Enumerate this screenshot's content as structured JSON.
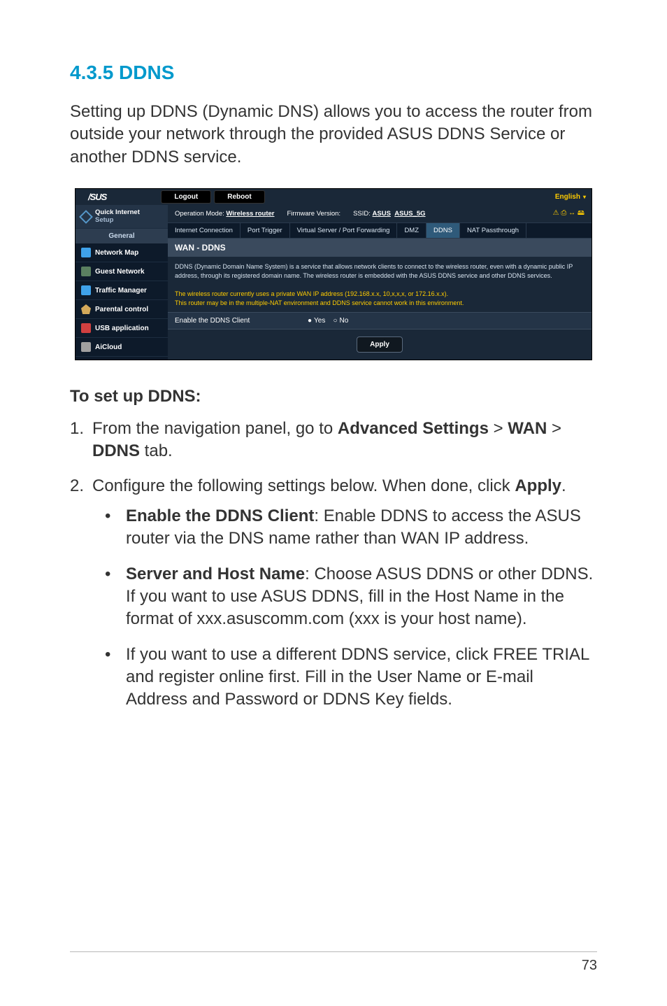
{
  "title": "4.3.5 DDNS",
  "intro": "Setting up DDNS (Dynamic DNS) allows you to access the router from outside your network through the provided ASUS DDNS Service or another DDNS service.",
  "screenshot": {
    "logo": "/SUS",
    "logout": "Logout",
    "reboot": "Reboot",
    "language": "English",
    "op_mode_lbl": "Operation Mode:",
    "op_mode_val": "Wireless router",
    "fw_lbl": "Firmware Version:",
    "ssid_lbl": "SSID:",
    "ssid_val1": "ASUS",
    "ssid_val2": "ASUS_5G",
    "status_icons": "⚠ ⎙ ↔ 🖴",
    "sidebar": {
      "quick1": "Quick Internet",
      "quick2": "Setup",
      "general": "General",
      "items": [
        {
          "label": "Network Map"
        },
        {
          "label": "Guest Network"
        },
        {
          "label": "Traffic Manager"
        },
        {
          "label": "Parental control"
        },
        {
          "label": "USB application"
        },
        {
          "label": "AiCloud"
        }
      ]
    },
    "tabs": {
      "t0": "Internet Connection",
      "t1": "Port Trigger",
      "t2": "Virtual Server / Port Forwarding",
      "t3": "DMZ",
      "t4": "DDNS",
      "t5": "NAT Passthrough"
    },
    "panel_title": "WAN - DDNS",
    "panel_desc": "DDNS (Dynamic Domain Name System) is a service that allows network clients to connect to the wireless router, even with a dynamic public IP address, through its registered domain name. The wireless router is embedded with the ASUS DDNS service and other DDNS services.",
    "panel_warn1": "The wireless router currently uses a private WAN IP address (192.168.x.x, 10,x,x,x, or 172.16.x.x).",
    "panel_warn2": "This router may be in the multiple-NAT environment and DDNS service cannot work in this environment.",
    "enable_lbl": "Enable the DDNS Client",
    "yes": "Yes",
    "no": "No",
    "apply": "Apply"
  },
  "sub": "To set up DDNS:",
  "step1_a": "From the navigation panel, go to ",
  "step1_b": "Advanced Settings",
  "step1_c": " > ",
  "step1_d": "WAN",
  "step1_e": " > ",
  "step1_f": "DDNS",
  "step1_g": " tab.",
  "step2_a": "Configure the following settings below. When done, click ",
  "step2_b": "Apply",
  "step2_c": ".",
  "b1_h": "Enable the DDNS Client",
  "b1_t": ": Enable DDNS to access the ASUS router via the DNS name rather than WAN IP address.",
  "b2_h": "Server and Host Name",
  "b2_t": ": Choose ASUS DDNS or other DDNS. If you want to use ASUS DDNS, fill in the Host Name in the format of xxx.asuscomm.com (xxx is your host name).",
  "b3_t": "If you want to use a different DDNS service, click FREE TRIAL and register online first. Fill in the User Name or E-mail Address and Password or DDNS Key fields.",
  "page_num": "73"
}
